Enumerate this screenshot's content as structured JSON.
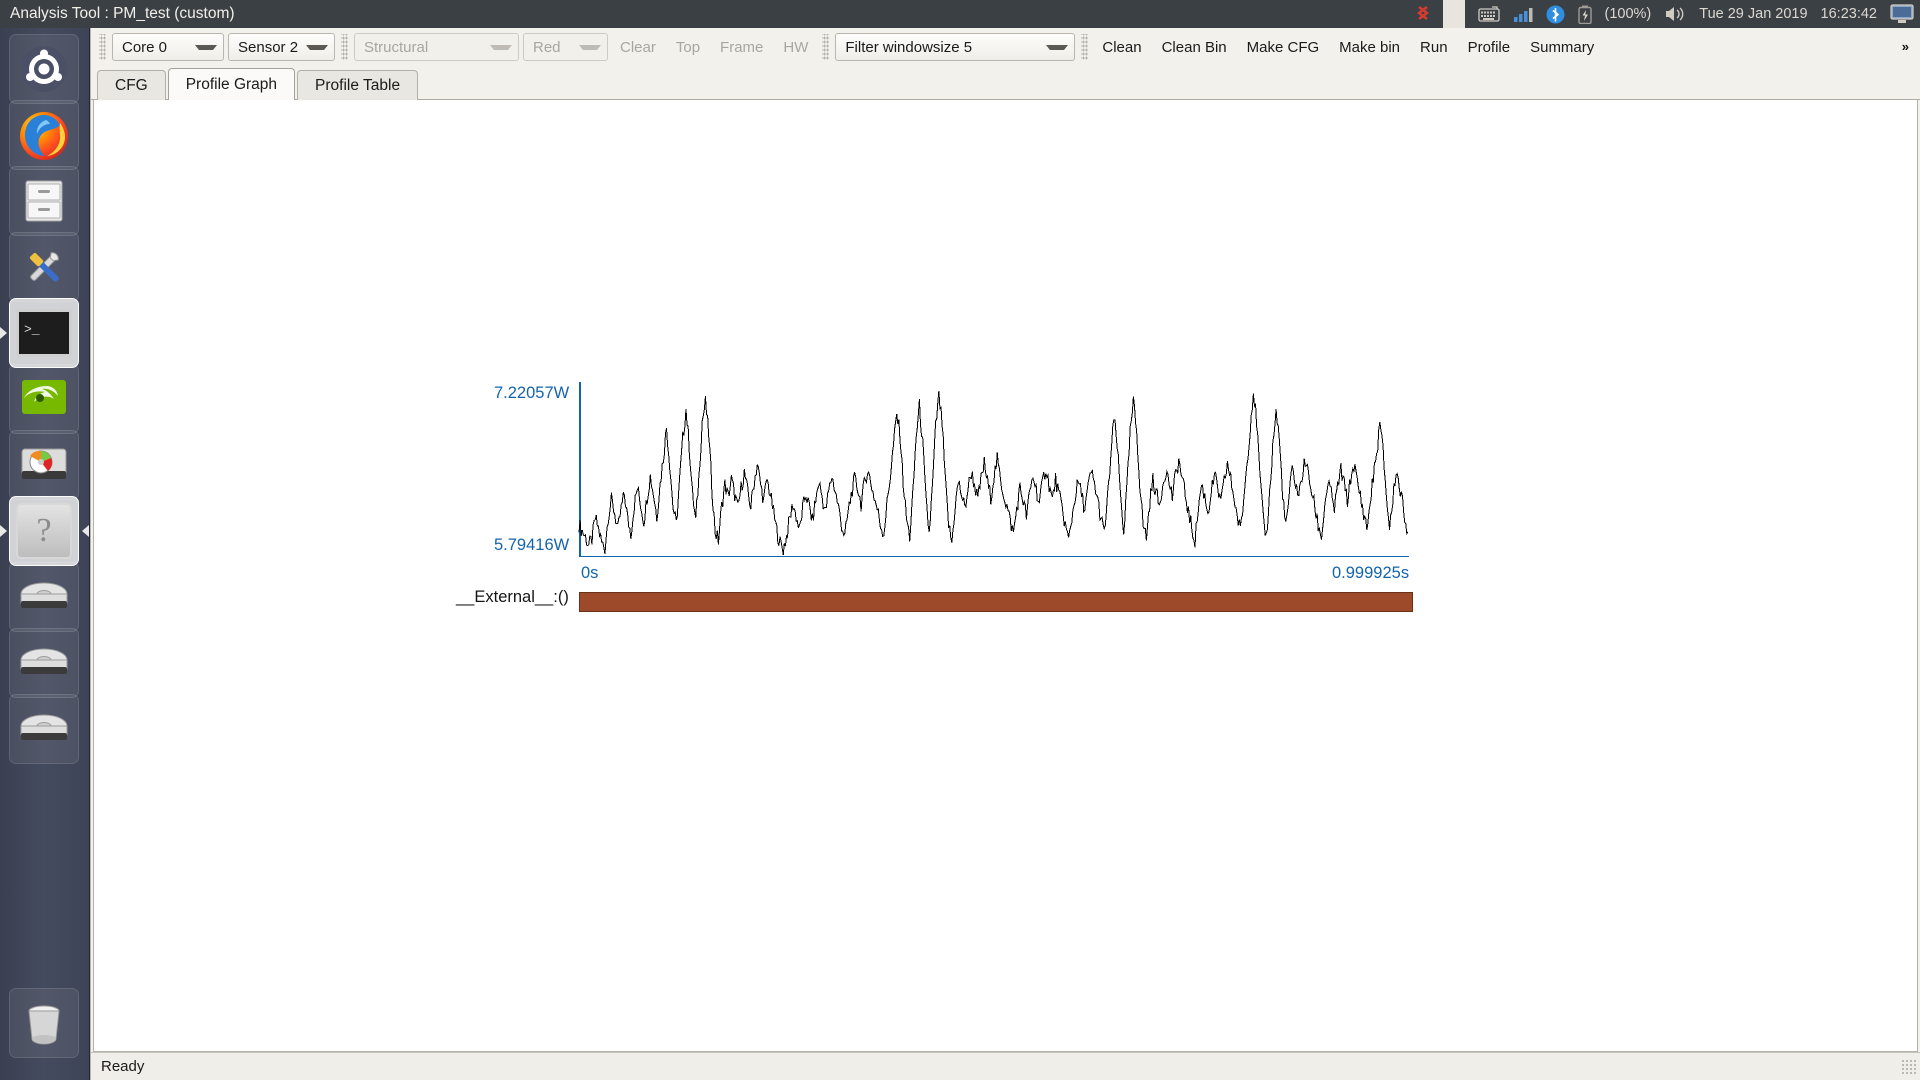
{
  "window": {
    "title": "Analysis Tool : PM_test (custom)"
  },
  "tray": {
    "keyboard_icon": "keyboard-icon",
    "signal_icon": "signal-bars-icon",
    "bluetooth_icon": "bluetooth-icon",
    "battery_icon": "battery-icon",
    "battery_label": "(100%)",
    "volume_icon": "volume-icon",
    "date": "Tue 29 Jan 2019",
    "time": "16:23:42",
    "session_icon": "display-session-icon",
    "indicator_icon": "red-indicator-icon"
  },
  "launcher": {
    "items": [
      {
        "name": "ubuntu-dash-icon",
        "glyph": "ubuntu",
        "active": false
      },
      {
        "name": "firefox-icon",
        "glyph": "firefox",
        "active": false
      },
      {
        "name": "files-icon",
        "glyph": "file-cabinet",
        "active": false
      },
      {
        "name": "system-settings-icon",
        "glyph": "tools",
        "active": false
      },
      {
        "name": "terminal-icon",
        "glyph": "terminal",
        "active": true
      },
      {
        "name": "nvidia-settings-icon",
        "glyph": "nvidia",
        "active": false
      },
      {
        "name": "disk-usage-icon",
        "glyph": "disk-usage",
        "active": false
      },
      {
        "name": "help-icon",
        "glyph": "question",
        "active": true
      },
      {
        "name": "drive-1-icon",
        "glyph": "hdd",
        "active": false
      },
      {
        "name": "drive-2-icon",
        "glyph": "hdd",
        "active": false
      },
      {
        "name": "drive-3-icon",
        "glyph": "hdd",
        "active": false
      },
      {
        "name": "trash-icon",
        "glyph": "trash",
        "active": false
      }
    ]
  },
  "toolbar": {
    "core_select": "Core 0",
    "sensor_select": "Sensor 2",
    "structural_select": "Structural",
    "color_select": "Red",
    "clear_label": "Clear",
    "top_label": "Top",
    "frame_label": "Frame",
    "hw_label": "HW",
    "filter_select": "Filter windowsize 5",
    "clean_label": "Clean",
    "clean_bin_label": "Clean Bin",
    "make_cfg_label": "Make CFG",
    "make_bin_label": "Make bin",
    "run_label": "Run",
    "profile_label": "Profile",
    "summary_label": "Summary",
    "overflow_label": "»"
  },
  "tabs": [
    {
      "label": "CFG",
      "selected": false
    },
    {
      "label": "Profile Graph",
      "selected": true
    },
    {
      "label": "Profile Table",
      "selected": false
    }
  ],
  "statusbar": {
    "message": "Ready"
  },
  "chart_data": {
    "type": "line",
    "title": "",
    "xlabel": "",
    "ylabel": "",
    "y_max_label": "7.22057W",
    "y_min_label": "5.79416W",
    "x_min_label": "0s",
    "x_max_label": "0.999925s",
    "ylim": [
      5.79416,
      7.22057
    ],
    "xlim": [
      0,
      0.999925
    ],
    "grid": false,
    "legend": "none",
    "axis_color": "#1464ad",
    "line_color": "#000000",
    "series": [
      {
        "name": "power",
        "values": [
          6.05,
          6.0,
          5.95,
          5.88,
          5.93,
          6.1,
          6.02,
          5.9,
          5.86,
          6.12,
          6.25,
          6.15,
          6.0,
          6.18,
          6.3,
          6.1,
          5.98,
          6.2,
          6.35,
          6.22,
          6.08,
          6.28,
          6.45,
          6.3,
          6.12,
          6.38,
          6.6,
          6.85,
          6.55,
          6.2,
          6.05,
          6.4,
          6.75,
          7.0,
          6.7,
          6.3,
          6.08,
          6.45,
          6.9,
          7.05,
          6.8,
          6.35,
          6.0,
          5.92,
          6.2,
          6.38,
          6.28,
          6.42,
          6.3,
          6.18,
          6.35,
          6.48,
          6.32,
          6.2,
          6.4,
          6.55,
          6.38,
          6.25,
          6.42,
          6.3,
          6.15,
          6.0,
          5.9,
          5.85,
          5.95,
          6.1,
          6.22,
          6.12,
          6.0,
          6.18,
          6.3,
          6.2,
          6.08,
          6.25,
          6.4,
          6.28,
          6.15,
          6.32,
          6.45,
          6.33,
          6.2,
          6.05,
          5.95,
          6.15,
          6.3,
          6.42,
          6.35,
          6.22,
          6.38,
          6.5,
          6.4,
          6.28,
          6.18,
          6.05,
          5.98,
          6.22,
          6.45,
          6.7,
          6.95,
          6.8,
          6.4,
          6.1,
          5.95,
          6.3,
          6.78,
          7.02,
          6.72,
          6.25,
          5.98,
          6.35,
          6.85,
          7.1,
          6.88,
          6.4,
          6.05,
          5.9,
          6.2,
          6.4,
          6.3,
          6.18,
          6.35,
          6.48,
          6.38,
          6.25,
          6.42,
          6.55,
          6.4,
          6.28,
          6.45,
          6.58,
          6.42,
          6.3,
          6.2,
          6.08,
          5.98,
          6.18,
          6.35,
          6.25,
          6.12,
          6.3,
          6.45,
          6.35,
          6.22,
          6.4,
          6.52,
          6.38,
          6.25,
          6.42,
          6.3,
          6.18,
          6.05,
          5.92,
          6.1,
          6.28,
          6.4,
          6.3,
          6.18,
          6.35,
          6.48,
          6.38,
          6.25,
          6.1,
          5.98,
          6.25,
          6.6,
          6.92,
          6.7,
          6.3,
          6.0,
          6.35,
          6.8,
          7.05,
          6.82,
          6.38,
          6.05,
          5.95,
          6.22,
          6.42,
          6.32,
          6.2,
          6.38,
          6.5,
          6.4,
          6.28,
          6.45,
          6.58,
          6.42,
          6.3,
          6.15,
          6.02,
          5.92,
          6.18,
          6.38,
          6.28,
          6.15,
          6.32,
          6.45,
          6.35,
          6.22,
          6.4,
          6.55,
          6.42,
          6.28,
          6.12,
          6.0,
          6.25,
          6.55,
          6.85,
          7.15,
          6.9,
          6.45,
          6.1,
          5.95,
          6.3,
          6.7,
          6.98,
          6.75,
          6.32,
          6.02,
          6.28,
          6.5,
          6.4,
          6.28,
          6.45,
          6.58,
          6.45,
          6.32,
          6.18,
          6.05,
          5.95,
          6.2,
          6.4,
          6.3,
          6.18,
          6.36,
          6.5,
          6.38,
          6.25,
          6.42,
          6.55,
          6.4,
          6.28,
          6.15,
          6.02,
          6.22,
          6.45,
          6.62,
          6.88,
          6.65,
          6.3,
          6.02,
          6.25,
          6.5,
          6.38,
          6.22,
          6.08,
          5.96
        ]
      }
    ],
    "timeline": {
      "label": "__External__:()",
      "color": "#9c4a2a",
      "start": 0,
      "end": 0.999925
    }
  }
}
